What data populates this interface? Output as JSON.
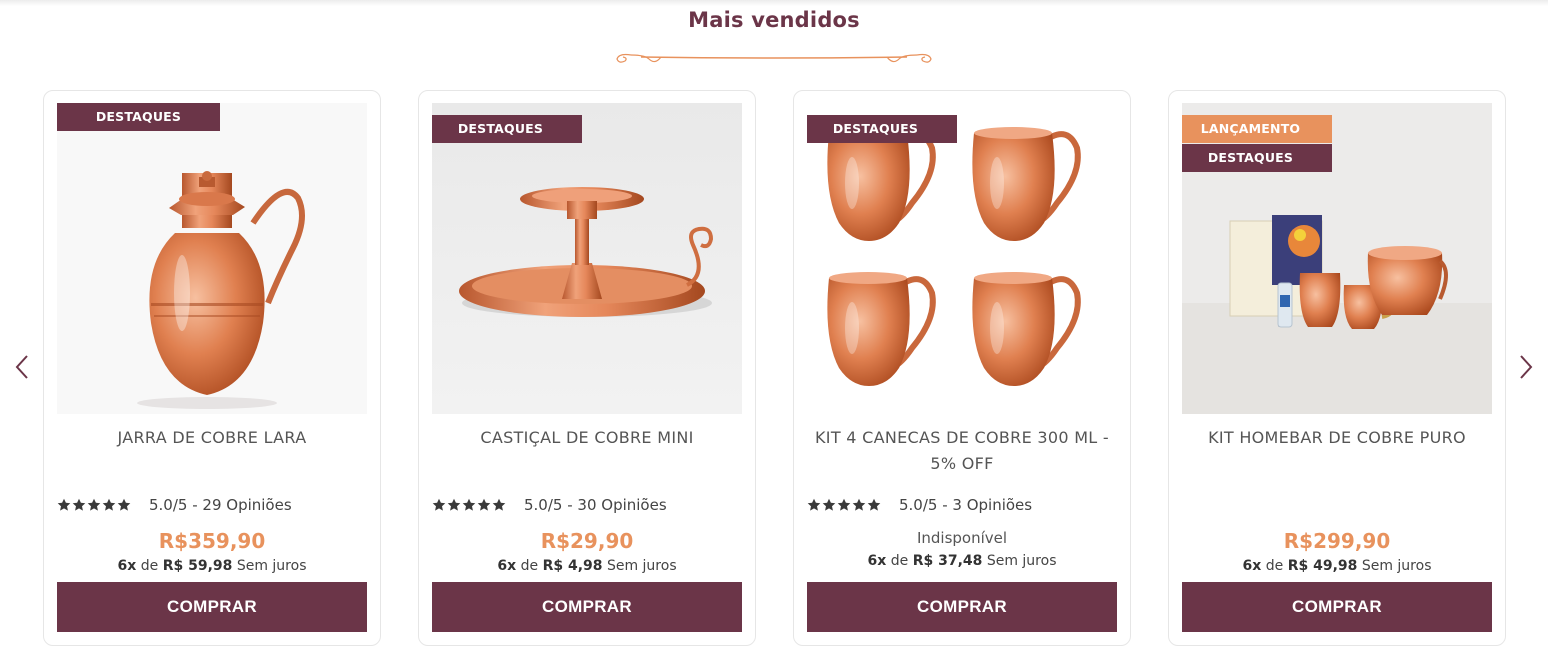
{
  "section": {
    "title": "Mais vendidos"
  },
  "colors": {
    "brand": "#6b3548",
    "accent": "#e8925d",
    "copper": "#d9784b"
  },
  "products": [
    {
      "name": "JARRA DE COBRE LARA",
      "badges": [
        "DESTAQUES"
      ],
      "rating": 5.0,
      "rating_text": "5.0/5 - 29 Opiniões",
      "price": "R$359,90",
      "installments_count": "6x",
      "installments_de": "de",
      "installments_value": "R$ 59,98",
      "installments_suffix": "Sem juros",
      "button": "COMPRAR"
    },
    {
      "name": "CASTIÇAL DE COBRE MINI",
      "badges": [
        "DESTAQUES"
      ],
      "rating": 5.0,
      "rating_text": "5.0/5 - 30 Opiniões",
      "price": "R$29,90",
      "installments_count": "6x",
      "installments_de": "de",
      "installments_value": "R$ 4,98",
      "installments_suffix": "Sem juros",
      "button": "COMPRAR"
    },
    {
      "name": "KIT 4 CANECAS DE COBRE 300 ML - 5% OFF",
      "badges": [
        "DESTAQUES"
      ],
      "rating": 5.0,
      "rating_text": "5.0/5 - 3 Opiniões",
      "availability": "Indisponível",
      "installments_count": "6x",
      "installments_de": "de",
      "installments_value": "R$ 37,48",
      "installments_suffix": "Sem juros",
      "button": "COMPRAR"
    },
    {
      "name": "KIT HOMEBAR DE COBRE PURO",
      "badges": [
        "LANÇAMENTO",
        "DESTAQUES"
      ],
      "price": "R$299,90",
      "installments_count": "6x",
      "installments_de": "de",
      "installments_value": "R$ 49,98",
      "installments_suffix": "Sem juros",
      "button": "COMPRAR"
    }
  ],
  "icons": {
    "prev": "chevron-left-icon",
    "next": "chevron-right-icon",
    "star": "star-icon"
  }
}
